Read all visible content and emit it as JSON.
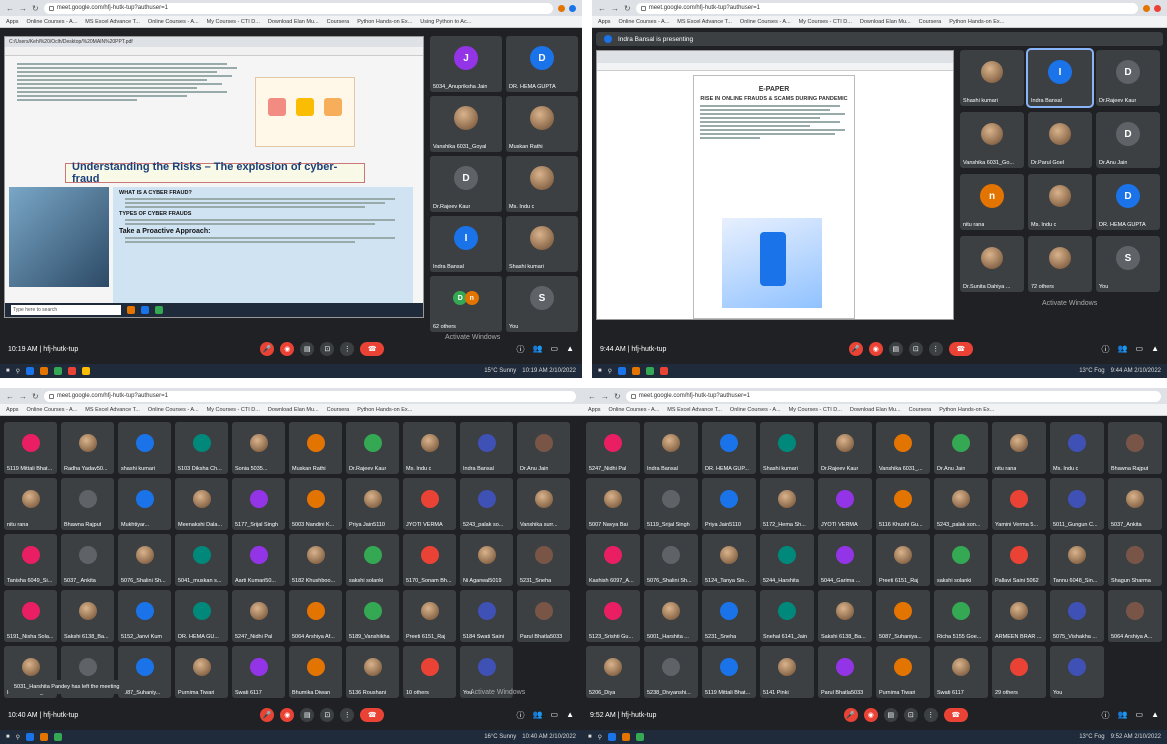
{
  "url_q1": "meet.google.com/hfj-hutk-tup?authuser=1",
  "url_q3": "meet.google.com/hfj-hutk-tup?authuser=1",
  "bookmarks": [
    "Apps",
    "Online Courses - A...",
    "MS Excel Advance T...",
    "Online Courses - A...",
    "My Courses - CTI D...",
    "Download Elan Mu...",
    "Coursera",
    "Python Hands-on Ex...",
    "Using Python to Ac...",
    "FAQs for Kotak 811...",
    "Reading list"
  ],
  "q1": {
    "time": "10:19 AM",
    "meeting_code": "hfj-hutk-tup",
    "pdf_url": "C:/Users/Kehl%20/Oclh/Desktop/%20MAIN%20PPT.pdf",
    "slide_heading": "Understanding the Risks – The explosion of cyber-fraud",
    "slide_section": "WHAT IS A CYBER FRAUD?",
    "slide_section2": "TYPES OF CYBER FRAUDS",
    "slide_section3": "Take a Proactive Approach:",
    "search_placeholder": "Type here to search",
    "tiles": [
      "5034_Anupriksha Jain",
      "DR. HEMA GUPTA",
      "Vanshika 6031_Goyal",
      "Muskan Rathi",
      "Dr.Rajeev Kaur",
      "Ms. Indu c",
      "Indra Bansal",
      "Shashi kumari",
      "62 others",
      "You"
    ],
    "weather": "15°C Sunny",
    "clock": "10:19 AM 2/10/2022",
    "activate": "Activate Windows"
  },
  "q2": {
    "time": "9:44 AM",
    "meeting_code": "hfj-hutk-tup",
    "presenting": "Indra Bansal is presenting",
    "doc_title": "E-PAPER",
    "doc_subtitle": "RISE IN ONLINE FRAUDS & SCAMS DURING PANDEMIC",
    "tiles": [
      "Shashi kumari",
      "Indra Bansal",
      "Dr.Rajeev Kaur",
      "Vanshika 6031_Go...",
      "Dr.Parul Goel",
      "Dr.Anu Jain",
      "nitu rana",
      "Ms. Indu c",
      "DR. HEMA GUPTA",
      "Dr.Sunita Dahiya ...",
      "72 others",
      "You"
    ],
    "weather": "13°C Fog",
    "clock": "9:44 AM 2/10/2022",
    "activate": "Activate Windows"
  },
  "q3": {
    "time": "10:40 AM",
    "meeting_code": "hfj-hutk-tup",
    "toast": "5031_Harshita Pandey has left the meeting",
    "tiles": [
      "5119 Mittali Bhat...",
      "Radha Yadav50...",
      "shashi kumari",
      "5103 Diksha Ch...",
      "Sonia 5035...",
      "Muskan Rathi",
      "Dr.Rajeev Kaur",
      "Ms. Indu c",
      "Indra Bansal",
      "Dr.Anu Jain",
      "nitu rana",
      "Bhawna Rajput",
      "Mukhtiyar...",
      "Meenakshi Dala...",
      "5177_Srijal Singh",
      "5003 Nandini K...",
      "Priya Jain5110",
      "JYOTI VERMA",
      "5243_palak so...",
      "Vanshika surr...",
      "Tanisha 6049_Si...",
      "5037_ Ankita",
      "5076_Shalini Sh...",
      "5041_muskan s...",
      "Aarti Kumari50...",
      "5182 Khushboo...",
      "sakshi solanki",
      "5170_Sonam Bh...",
      "Ni Agarwal5019",
      "5231_Sneha",
      "5191_Nisha Sola...",
      "Sakshi 6138_Ba...",
      "5152_Janvi Kum",
      "DR. HEMA GU...",
      "5247_Nidhi Pal",
      "5064 Arshiya Af...",
      "5189_Vanshikha",
      "Preeti 6151_Raj",
      "5184 Swati Saini",
      "Parul Bhatla5033",
      "Praneet 6027_A...",
      "Isha 6031",
      "5087_Suhaniy...",
      "Purnima Tiwari",
      "Swati 6117",
      "Bhumika Diwan",
      "5136 Roushani",
      "10 others",
      "You"
    ],
    "weather": "16°C Sunny",
    "clock": "10:40 AM 2/10/2022",
    "activate": "Activate Windows"
  },
  "q4": {
    "time": "9:52 AM",
    "meeting_code": "hfj-hutk-tup",
    "tiles": [
      "5247_Nidhi Pal",
      "Indra Bansal",
      "DR. HEMA GUP...",
      "Shashi kumari",
      "Dr.Rajeev Kaur",
      "Vanshika 6031_...",
      "Dr.Anu Jain",
      "nitu rana",
      "Ms. Indu c",
      "Bhawna Rajput",
      "5007 Navya Bai",
      "5119_Srijal Singh",
      "Priya Jain5110",
      "5172_Hema Sh...",
      "JYOTI VERMA",
      "5116 Khushi Gu...",
      "5243_palak son...",
      "Yamini Verma 5...",
      "5011_Gungun C...",
      "5037_Ankita",
      "Kashish 6097_A...",
      "5076_Shalini Sh...",
      "5124_Tanya Sin...",
      "5244_Harshita",
      "5044_Garima ...",
      "Preeti 6151_Raj",
      "sakshi solanki",
      "Pallavi Saini 5062",
      "Tannu 6048_Sin...",
      "Shagun Sharma",
      "5123_Srishti Gu...",
      "5001_Harshita ...",
      "5231_Sneha",
      "Snehal 6141_Jain",
      "Sakshi 6138_Ba...",
      "5087_Suhaniya...",
      "Richa 5155 Goe...",
      "ARMEEN BRAR ...",
      "5075_Vishakha ...",
      "5064 Arshiya A...",
      "5206_Diya",
      "5238_Divyanshi...",
      "5119 Mittali Bhat...",
      "5141 Pinki",
      "Parul Bhatla5033",
      "Purnima Tiwari",
      "Swati 6117",
      "29 others",
      "You"
    ],
    "weather": "13°C Fog",
    "clock": "9:52 AM 2/10/2022"
  },
  "colors": {
    "meet_bg": "#202124",
    "tile_bg": "#3c4043",
    "end_call": "#ea4335",
    "accent": "#8ab4f8"
  }
}
